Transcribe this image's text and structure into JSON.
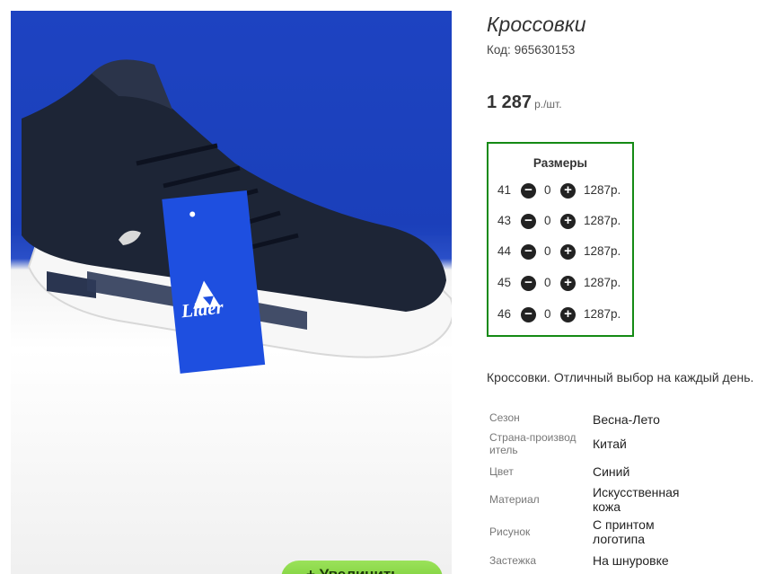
{
  "product": {
    "title": "Кроссовки",
    "code_label": "Код:",
    "code_value": "965630153",
    "price_value": "1 287",
    "price_unit": "р./шт.",
    "description": "Кроссовки. Отличный выбор на каждый день.",
    "zoom_label": "+ Увеличить"
  },
  "sizes": {
    "title": "Размеры",
    "rows": [
      {
        "size": "41",
        "qty": "0",
        "price": "1287р."
      },
      {
        "size": "43",
        "qty": "0",
        "price": "1287р."
      },
      {
        "size": "44",
        "qty": "0",
        "price": "1287р."
      },
      {
        "size": "45",
        "qty": "0",
        "price": "1287р."
      },
      {
        "size": "46",
        "qty": "0",
        "price": "1287р."
      }
    ],
    "minus_glyph": "−",
    "plus_glyph": "+"
  },
  "properties": [
    {
      "key": "Сезон",
      "value": "Весна-Лето"
    },
    {
      "key": "Страна-производитель",
      "value": "Китай"
    },
    {
      "key": "Цвет",
      "value": "Синий"
    },
    {
      "key": "Материал",
      "value": "Искусственная кожа"
    },
    {
      "key": "Рисунок",
      "value": "С принтом логотипа"
    },
    {
      "key": "Застежка",
      "value": "На шнуровке"
    }
  ],
  "tag_brand": "Lider",
  "colors": {
    "border_green": "#148a14",
    "button_green": "#7ed23c",
    "box_blue": "#1f45c4"
  },
  "icons": [
    "minus-circle-icon",
    "plus-circle-icon",
    "product-photo"
  ]
}
